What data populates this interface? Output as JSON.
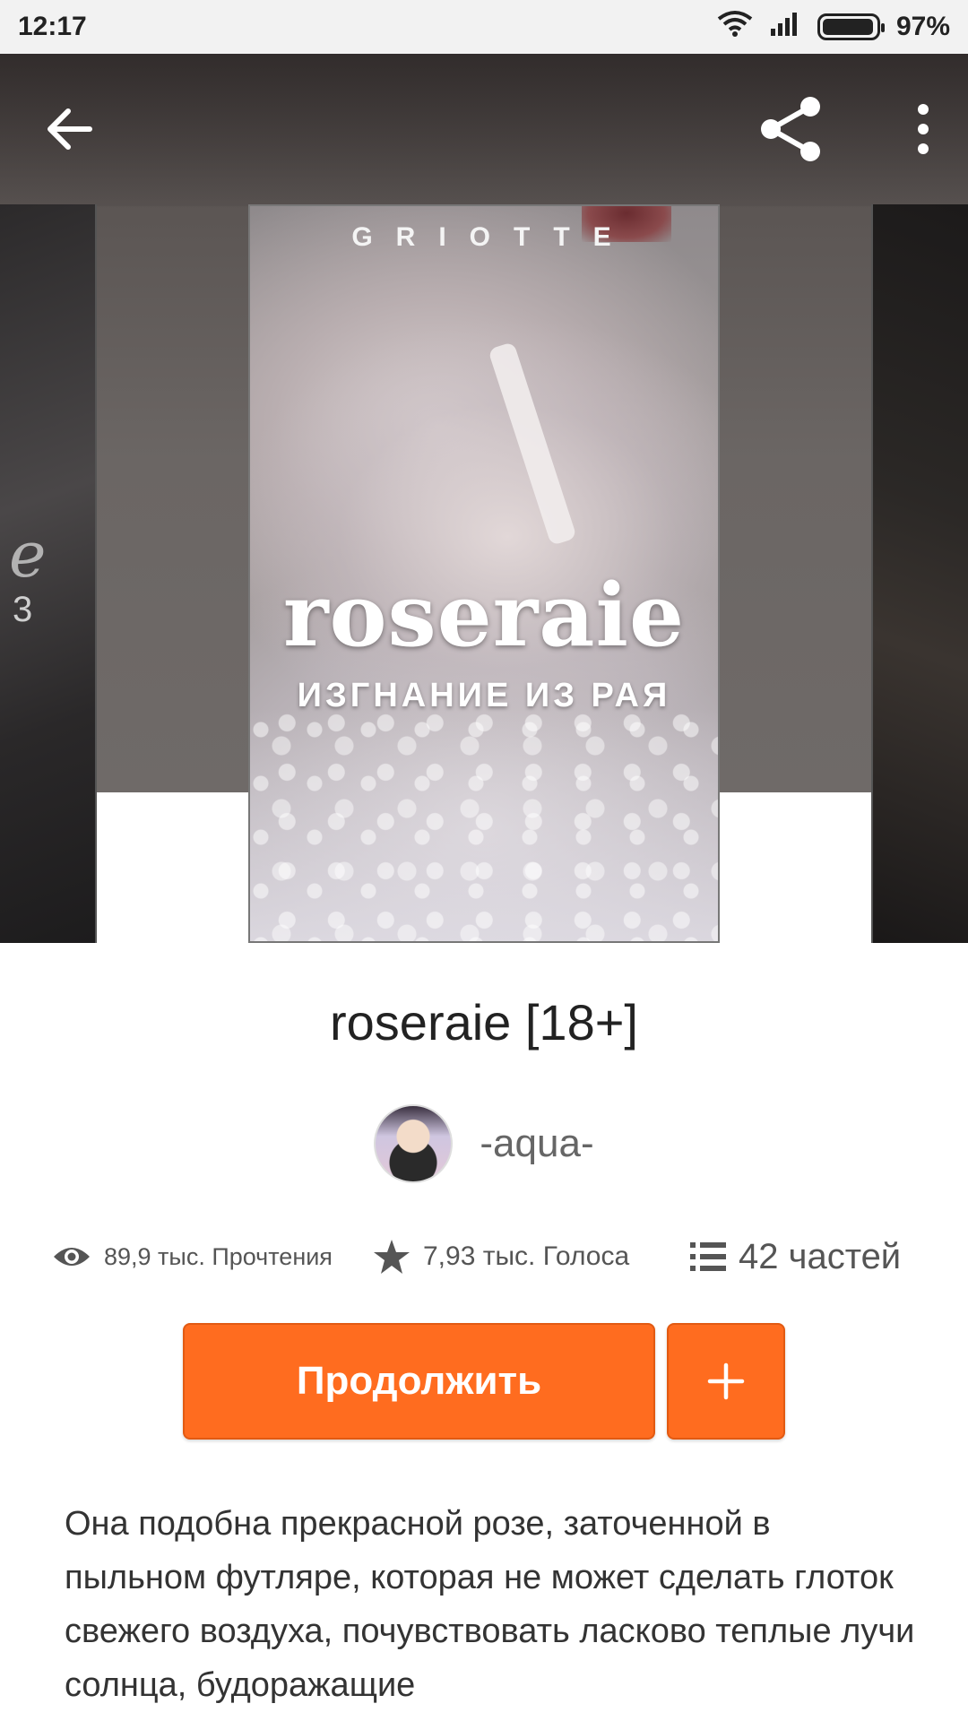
{
  "status_bar": {
    "time": "12:17",
    "battery_percent": "97%",
    "battery_level": 0.97
  },
  "toolbar": {
    "back_icon": "arrow-left-icon",
    "share_icon": "share-icon",
    "menu_icon": "more-vertical-icon"
  },
  "cover": {
    "author_mark": "GRIOTTE",
    "title": "roseraie",
    "subtitle": "ИЗГНАНИЕ ИЗ РАЯ",
    "left_mark": "e",
    "left_number": "3"
  },
  "story": {
    "title": "roseraie [18+]",
    "author": "-aqua-"
  },
  "stats": {
    "reads": "89,9 тыс. Прочтения",
    "votes": "7,93 тыс. Голоса",
    "parts": "42 частей"
  },
  "actions": {
    "continue_label": "Продолжить",
    "add_label": "+"
  },
  "description": "Она подобна прекрасной розе, заточенной в пыльном футляре, которая не может сделать глоток свежего воздуха, почувствовать ласково теплые лучи солнца, будоражащие",
  "colors": {
    "accent": "#ff6c1f",
    "text_primary": "#222222",
    "text_secondary": "#666666"
  }
}
